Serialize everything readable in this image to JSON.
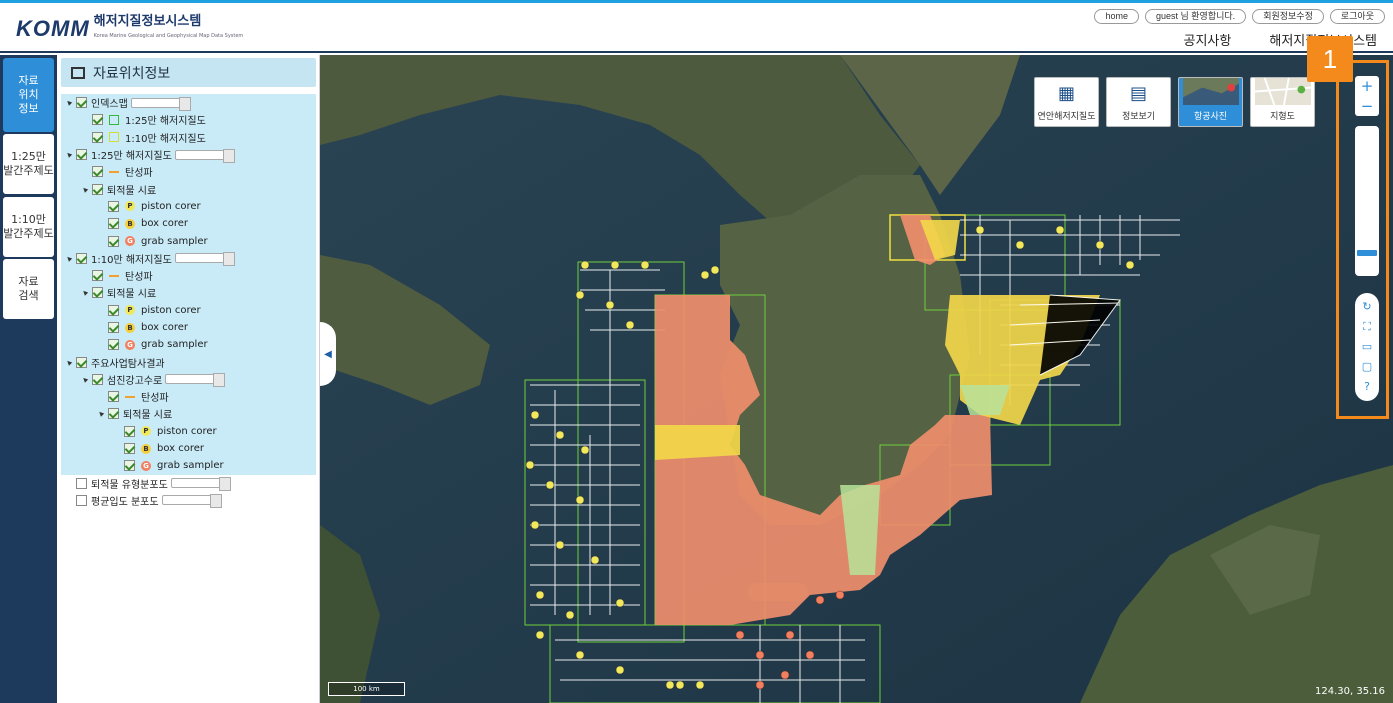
{
  "header": {
    "brand": "KOMM",
    "system_name": "해저지질정보시스템",
    "system_sub": "Korea Marine Geological and Geophysical Map Data System",
    "top_buttons": [
      "home",
      "guest 님 환영합니다.",
      "회원정보수정",
      "로그아웃"
    ],
    "nav": [
      "공지사항",
      "해저지질정보시스템"
    ]
  },
  "left_tabs": [
    "자료\n위치\n정보",
    "1:25만\n발간주제도",
    "1:10만\n발간주제도",
    "자료\n검색"
  ],
  "panel": {
    "title": "자료위치정보",
    "tree": [
      {
        "label": "인덱스맵",
        "level": 0,
        "tri": "◢",
        "checked": true,
        "slider": true,
        "hl": true
      },
      {
        "label": "1:25만 해저지질도",
        "level": 1,
        "checked": true,
        "legend": "sq1",
        "hl": true
      },
      {
        "label": "1:10만 해저지질도",
        "level": 1,
        "checked": true,
        "legend": "sq2",
        "hl": true
      },
      {
        "label": "1:25만 해저지질도",
        "level": 0,
        "tri": "◢",
        "checked": true,
        "slider": true,
        "hl": true
      },
      {
        "label": "탄성파",
        "level": 1,
        "checked": true,
        "legend": "line",
        "hl": true
      },
      {
        "label": "퇴적물 시료",
        "level": 1,
        "tri": "◢",
        "checked": true,
        "hl": true
      },
      {
        "label": "piston corer",
        "level": 2,
        "checked": true,
        "legend": "p",
        "hl": true
      },
      {
        "label": "box corer",
        "level": 2,
        "checked": true,
        "legend": "b",
        "hl": true
      },
      {
        "label": "grab sampler",
        "level": 2,
        "checked": true,
        "legend": "g",
        "hl": true
      },
      {
        "label": "1:10만 해저지질도",
        "level": 0,
        "tri": "◢",
        "checked": true,
        "slider": true,
        "hl": true
      },
      {
        "label": "탄성파",
        "level": 1,
        "checked": true,
        "legend": "line",
        "hl": true
      },
      {
        "label": "퇴적물 시료",
        "level": 1,
        "tri": "◢",
        "checked": true,
        "hl": true
      },
      {
        "label": "piston corer",
        "level": 2,
        "checked": true,
        "legend": "p",
        "hl": true
      },
      {
        "label": "box corer",
        "level": 2,
        "checked": true,
        "legend": "b",
        "hl": true
      },
      {
        "label": "grab sampler",
        "level": 2,
        "checked": true,
        "legend": "g",
        "hl": true
      },
      {
        "label": "주요사업탐사결과",
        "level": 0,
        "tri": "◢",
        "checked": true,
        "hl": true
      },
      {
        "label": "섬진강고수로",
        "level": 1,
        "tri": "◢",
        "checked": true,
        "slider": true,
        "hl": true
      },
      {
        "label": "탄성파",
        "level": 2,
        "checked": true,
        "legend": "line",
        "hl": true
      },
      {
        "label": "퇴적물 시료",
        "level": 2,
        "tri": "◢",
        "checked": true,
        "hl": true
      },
      {
        "label": "piston corer",
        "level": 3,
        "checked": true,
        "legend": "p",
        "hl": true
      },
      {
        "label": "box corer",
        "level": 3,
        "checked": true,
        "legend": "b",
        "hl": true
      },
      {
        "label": "grab sampler",
        "level": 3,
        "checked": true,
        "legend": "g",
        "hl": true
      },
      {
        "label": "퇴적물 유형분포도",
        "level": 0,
        "checked": false,
        "slider": true,
        "hl": false
      },
      {
        "label": "평균입도 분포도",
        "level": 0,
        "checked": false,
        "slider": true,
        "hl": false
      }
    ]
  },
  "map": {
    "layer_buttons": [
      {
        "label": "연안해저지질도",
        "icon": "grid-icon",
        "active": false
      },
      {
        "label": "정보보기",
        "icon": "document-icon",
        "active": false
      },
      {
        "label": "항공사진",
        "icon": "aerial-thumb-icon",
        "active": true
      },
      {
        "label": "지형도",
        "icon": "terrain-thumb-icon",
        "active": false
      }
    ],
    "zoom_in": "+",
    "zoom_out": "−",
    "zoom_level_fraction": 0.85,
    "tools": [
      "refresh-icon",
      "fullextent-icon",
      "measure-icon",
      "screen-icon",
      "help-icon"
    ],
    "highlight_badge": "1",
    "scale_label": "100 km",
    "coords": "124.30, 35.16"
  },
  "colors": {
    "accent": "#2e8ed8",
    "highlight": "#f58a1c",
    "nav_dark": "#1d3a5c",
    "grab": "#f08060",
    "piston": "#f1e85c",
    "box": "#f5d03c",
    "survey_box": "#6fcf3a"
  }
}
